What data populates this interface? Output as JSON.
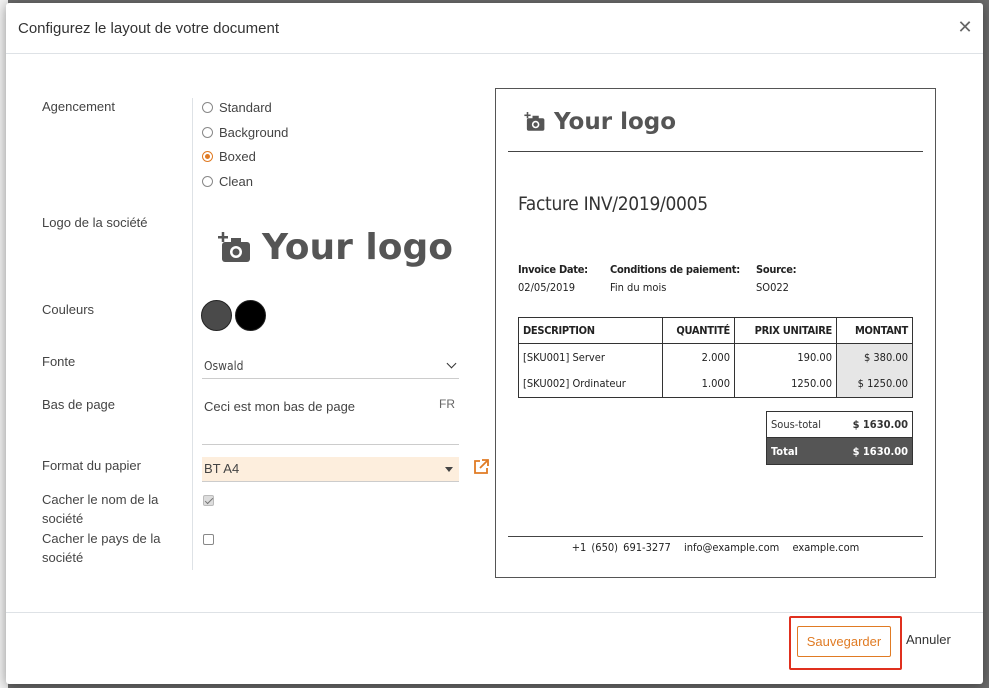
{
  "modal": {
    "title": "Configurez le layout de votre document",
    "close_icon": "close-icon"
  },
  "form": {
    "layout_label": "Agencement",
    "layout_options": [
      "Standard",
      "Background",
      "Boxed",
      "Clean"
    ],
    "layout_selected": "Boxed",
    "logo_label": "Logo de la société",
    "logo_text": "Your logo",
    "colors_label": "Couleurs",
    "colors": [
      "#4a4a4a",
      "#000000"
    ],
    "font_label": "Fonte",
    "font_value": "Oswald",
    "footer_label": "Bas de page",
    "footer_value": "Ceci est mon bas de page",
    "footer_lang": "FR",
    "paper_label": "Format du papier",
    "paper_value": "BT A4",
    "hide_name_label_1": "Cacher le nom de la",
    "hide_name_label_2": "société",
    "hide_name_checked": true,
    "hide_country_label_1": "Cacher le pays de la",
    "hide_country_label_2": "société",
    "hide_country_checked": false
  },
  "preview": {
    "logo_text": "Your logo",
    "title": "Facture INV/2019/0005",
    "invoice_date_label": "Invoice Date:",
    "invoice_date": "02/05/2019",
    "terms_label": "Conditions de paiement:",
    "terms": "Fin du mois",
    "source_label": "Source:",
    "source": "SO022",
    "columns": [
      "DESCRIPTION",
      "QUANTITÉ",
      "PRIX UNITAIRE",
      "MONTANT"
    ],
    "rows": [
      {
        "desc": "[SKU001] Server",
        "qty": "2.000",
        "price": "190.00",
        "amount": "$ 380.00"
      },
      {
        "desc": "[SKU002] Ordinateur",
        "qty": "1.000",
        "price": "1250.00",
        "amount": "$ 1250.00"
      }
    ],
    "subtotal_label": "Sous-total",
    "subtotal": "$ 1630.00",
    "total_label": "Total",
    "total": "$ 1630.00",
    "phone": "+1 (650) 691-3277",
    "email": "info@example.com",
    "website": "example.com"
  },
  "footer": {
    "save_label": "Sauvegarder",
    "cancel_label": "Annuler"
  },
  "accent_color": "#e07b24"
}
